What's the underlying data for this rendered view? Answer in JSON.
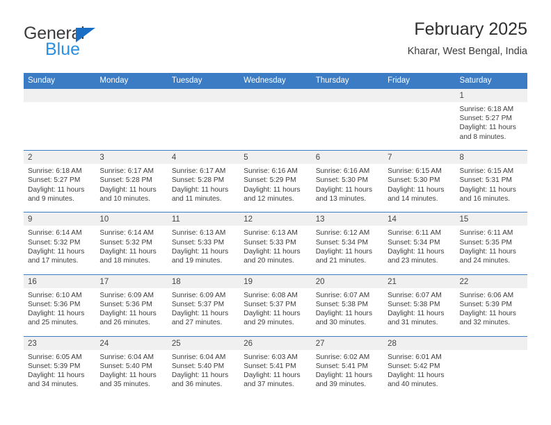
{
  "logo": {
    "word_one": "General",
    "word_two": "Blue",
    "triangle_icon": "blue-triangle-icon"
  },
  "header": {
    "title": "February 2025",
    "subtitle": "Kharar, West Bengal, India"
  },
  "colors": {
    "header_blue": "#3b7cc4",
    "day_band_gray": "#f0f0f0",
    "logo_blue": "#2b8fe0",
    "logo_dark": "#3c3c3c",
    "text": "#3c3c3c"
  },
  "weekdays": [
    "Sunday",
    "Monday",
    "Tuesday",
    "Wednesday",
    "Thursday",
    "Friday",
    "Saturday"
  ],
  "weeks": [
    [
      {
        "day": "",
        "empty": true
      },
      {
        "day": "",
        "empty": true
      },
      {
        "day": "",
        "empty": true
      },
      {
        "day": "",
        "empty": true
      },
      {
        "day": "",
        "empty": true
      },
      {
        "day": "",
        "empty": true
      },
      {
        "day": "1",
        "sunrise": "Sunrise: 6:18 AM",
        "sunset": "Sunset: 5:27 PM",
        "daylight": "Daylight: 11 hours and 8 minutes."
      }
    ],
    [
      {
        "day": "2",
        "sunrise": "Sunrise: 6:18 AM",
        "sunset": "Sunset: 5:27 PM",
        "daylight": "Daylight: 11 hours and 9 minutes."
      },
      {
        "day": "3",
        "sunrise": "Sunrise: 6:17 AM",
        "sunset": "Sunset: 5:28 PM",
        "daylight": "Daylight: 11 hours and 10 minutes."
      },
      {
        "day": "4",
        "sunrise": "Sunrise: 6:17 AM",
        "sunset": "Sunset: 5:28 PM",
        "daylight": "Daylight: 11 hours and 11 minutes."
      },
      {
        "day": "5",
        "sunrise": "Sunrise: 6:16 AM",
        "sunset": "Sunset: 5:29 PM",
        "daylight": "Daylight: 11 hours and 12 minutes."
      },
      {
        "day": "6",
        "sunrise": "Sunrise: 6:16 AM",
        "sunset": "Sunset: 5:30 PM",
        "daylight": "Daylight: 11 hours and 13 minutes."
      },
      {
        "day": "7",
        "sunrise": "Sunrise: 6:15 AM",
        "sunset": "Sunset: 5:30 PM",
        "daylight": "Daylight: 11 hours and 14 minutes."
      },
      {
        "day": "8",
        "sunrise": "Sunrise: 6:15 AM",
        "sunset": "Sunset: 5:31 PM",
        "daylight": "Daylight: 11 hours and 16 minutes."
      }
    ],
    [
      {
        "day": "9",
        "sunrise": "Sunrise: 6:14 AM",
        "sunset": "Sunset: 5:32 PM",
        "daylight": "Daylight: 11 hours and 17 minutes."
      },
      {
        "day": "10",
        "sunrise": "Sunrise: 6:14 AM",
        "sunset": "Sunset: 5:32 PM",
        "daylight": "Daylight: 11 hours and 18 minutes."
      },
      {
        "day": "11",
        "sunrise": "Sunrise: 6:13 AM",
        "sunset": "Sunset: 5:33 PM",
        "daylight": "Daylight: 11 hours and 19 minutes."
      },
      {
        "day": "12",
        "sunrise": "Sunrise: 6:13 AM",
        "sunset": "Sunset: 5:33 PM",
        "daylight": "Daylight: 11 hours and 20 minutes."
      },
      {
        "day": "13",
        "sunrise": "Sunrise: 6:12 AM",
        "sunset": "Sunset: 5:34 PM",
        "daylight": "Daylight: 11 hours and 21 minutes."
      },
      {
        "day": "14",
        "sunrise": "Sunrise: 6:11 AM",
        "sunset": "Sunset: 5:34 PM",
        "daylight": "Daylight: 11 hours and 23 minutes."
      },
      {
        "day": "15",
        "sunrise": "Sunrise: 6:11 AM",
        "sunset": "Sunset: 5:35 PM",
        "daylight": "Daylight: 11 hours and 24 minutes."
      }
    ],
    [
      {
        "day": "16",
        "sunrise": "Sunrise: 6:10 AM",
        "sunset": "Sunset: 5:36 PM",
        "daylight": "Daylight: 11 hours and 25 minutes."
      },
      {
        "day": "17",
        "sunrise": "Sunrise: 6:09 AM",
        "sunset": "Sunset: 5:36 PM",
        "daylight": "Daylight: 11 hours and 26 minutes."
      },
      {
        "day": "18",
        "sunrise": "Sunrise: 6:09 AM",
        "sunset": "Sunset: 5:37 PM",
        "daylight": "Daylight: 11 hours and 27 minutes."
      },
      {
        "day": "19",
        "sunrise": "Sunrise: 6:08 AM",
        "sunset": "Sunset: 5:37 PM",
        "daylight": "Daylight: 11 hours and 29 minutes."
      },
      {
        "day": "20",
        "sunrise": "Sunrise: 6:07 AM",
        "sunset": "Sunset: 5:38 PM",
        "daylight": "Daylight: 11 hours and 30 minutes."
      },
      {
        "day": "21",
        "sunrise": "Sunrise: 6:07 AM",
        "sunset": "Sunset: 5:38 PM",
        "daylight": "Daylight: 11 hours and 31 minutes."
      },
      {
        "day": "22",
        "sunrise": "Sunrise: 6:06 AM",
        "sunset": "Sunset: 5:39 PM",
        "daylight": "Daylight: 11 hours and 32 minutes."
      }
    ],
    [
      {
        "day": "23",
        "sunrise": "Sunrise: 6:05 AM",
        "sunset": "Sunset: 5:39 PM",
        "daylight": "Daylight: 11 hours and 34 minutes."
      },
      {
        "day": "24",
        "sunrise": "Sunrise: 6:04 AM",
        "sunset": "Sunset: 5:40 PM",
        "daylight": "Daylight: 11 hours and 35 minutes."
      },
      {
        "day": "25",
        "sunrise": "Sunrise: 6:04 AM",
        "sunset": "Sunset: 5:40 PM",
        "daylight": "Daylight: 11 hours and 36 minutes."
      },
      {
        "day": "26",
        "sunrise": "Sunrise: 6:03 AM",
        "sunset": "Sunset: 5:41 PM",
        "daylight": "Daylight: 11 hours and 37 minutes."
      },
      {
        "day": "27",
        "sunrise": "Sunrise: 6:02 AM",
        "sunset": "Sunset: 5:41 PM",
        "daylight": "Daylight: 11 hours and 39 minutes."
      },
      {
        "day": "28",
        "sunrise": "Sunrise: 6:01 AM",
        "sunset": "Sunset: 5:42 PM",
        "daylight": "Daylight: 11 hours and 40 minutes."
      },
      {
        "day": "",
        "empty": true
      }
    ]
  ]
}
